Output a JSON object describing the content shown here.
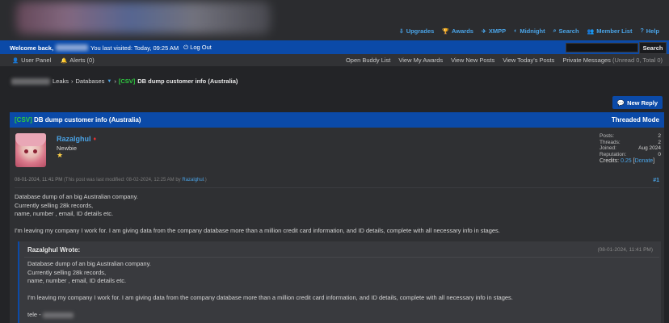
{
  "header": {
    "links": [
      {
        "icon": "upgrades-icon",
        "glyph": "⇩",
        "label": "Upgrades"
      },
      {
        "icon": "awards-icon",
        "glyph": "🏆",
        "label": "Awards"
      },
      {
        "icon": "xmpp-icon",
        "glyph": "✈",
        "label": "XMPP"
      },
      {
        "icon": "midnight-icon",
        "glyph": "◐",
        "label": "Midnight"
      },
      {
        "icon": "search-icon",
        "glyph": "⌕",
        "label": "Search"
      },
      {
        "icon": "member-list-icon",
        "glyph": "👥",
        "label": "Member List"
      },
      {
        "icon": "help-icon",
        "glyph": "?",
        "label": "Help"
      }
    ]
  },
  "welcome": {
    "prefix": "Welcome back,",
    "last_visited": "You last visited: Today, 09:25 AM",
    "logout": "Log Out",
    "search_button": "Search"
  },
  "userbar": {
    "user_panel": "User Panel",
    "alerts": "Alerts (0)",
    "links": [
      "Open Buddy List",
      "View My Awards",
      "View New Posts",
      "View Today's Posts"
    ],
    "pm_label": "Private Messages",
    "pm_counts": "(Unread 0, Total 0)"
  },
  "breadcrumb": {
    "leaks": "Leaks",
    "sep": "›",
    "databases": "Databases",
    "tag": "[CSV]",
    "current": "DB dump customer info (Australia)"
  },
  "new_reply": "New Reply",
  "thread": {
    "tag": "[CSV]",
    "title": "DB dump customer info (Australia)",
    "mode": "Threaded Mode"
  },
  "post": {
    "username": "Razalghul",
    "usertitle": "Newbie",
    "star": "★",
    "stats": [
      {
        "label": "Posts:",
        "value": "2"
      },
      {
        "label": "Threads:",
        "value": "2"
      },
      {
        "label": "Joined:",
        "value": "Aug 2024"
      },
      {
        "label": "Reputation:",
        "value": "0"
      }
    ],
    "credits_label": "Credits:",
    "credits_value": "0.25",
    "donate": "Donate",
    "date": "08-01-2024, 11:41 PM",
    "modified_text": "(This post was last modified: 08-02-2024, 12:25 AM by",
    "modified_by": "Razalghul",
    "modified_end": ".)",
    "number": "#1",
    "lines": [
      "Database dump of an big Australian company.",
      "Currently selling 28k records,",
      "name, number , email, ID details etc."
    ],
    "paragraph": "I'm leaving my company I work for. I am giving data from the company database more than a million credit card information, and ID details, complete with all necessary info in stages."
  },
  "quote": {
    "head": "Razalghul Wrote:",
    "date": "(08-01-2024, 11:41 PM)",
    "lines": [
      "Database dump of an big Australian company.",
      "Currently selling 28k records,",
      "name, number , email, ID details etc."
    ],
    "paragraph": "I'm leaving my company I work for. I am giving data from the company database more than a million credit card information, and ID details, complete with all necessary info in stages.",
    "tele": "tele -"
  },
  "colors": {
    "accent": "#0b4aa8",
    "link": "#4aa3e6",
    "tag": "#2ecc40",
    "background": "#232427"
  }
}
